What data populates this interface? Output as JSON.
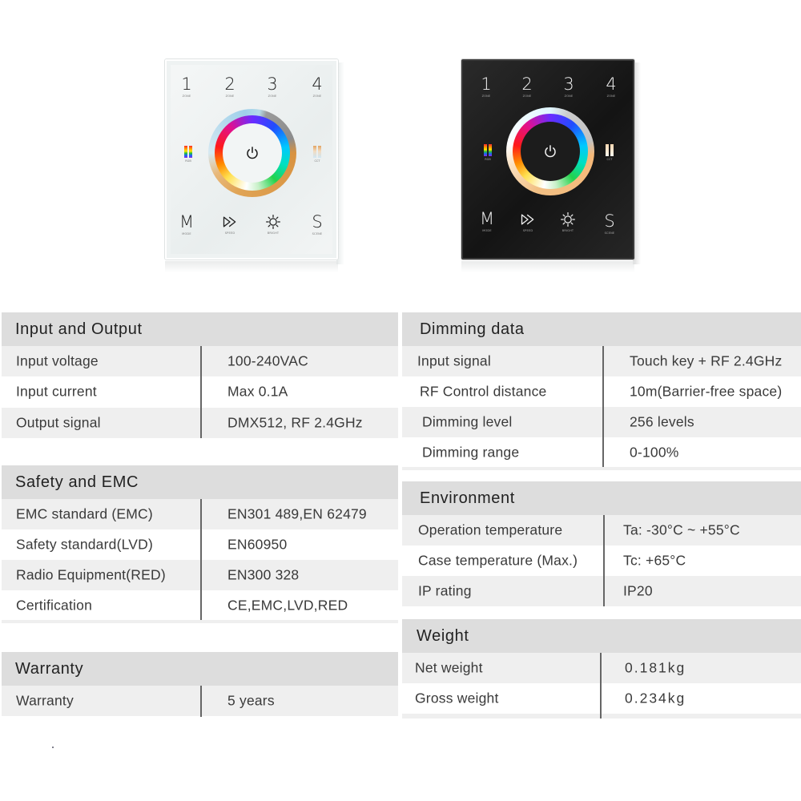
{
  "products": {
    "white_panel": {
      "variant": "white",
      "zone_keys": [
        {
          "number": "1",
          "label": "ZONE"
        },
        {
          "number": "2",
          "label": "ZONE"
        },
        {
          "number": "3",
          "label": "ZONE"
        },
        {
          "number": "4",
          "label": "ZONE"
        }
      ],
      "left_mode_label": "RGB",
      "right_mode_label": "CCT",
      "bottom_keys": [
        {
          "glyph": "M",
          "label": "MODE"
        },
        {
          "glyph": "speed-icon",
          "label": "SPEED"
        },
        {
          "glyph": "brightness-icon",
          "label": "BRIGHT"
        },
        {
          "glyph": "S",
          "label": "SCENE"
        }
      ]
    },
    "black_panel": {
      "variant": "black",
      "zone_keys": [
        {
          "number": "1",
          "label": "ZONE"
        },
        {
          "number": "2",
          "label": "ZONE"
        },
        {
          "number": "3",
          "label": "ZONE"
        },
        {
          "number": "4",
          "label": "ZONE"
        }
      ],
      "left_mode_label": "RGB",
      "right_mode_label": "CCT",
      "bottom_keys": [
        {
          "glyph": "M",
          "label": "MODE"
        },
        {
          "glyph": "speed-icon",
          "label": "SPEED"
        },
        {
          "glyph": "brightness-icon",
          "label": "BRIGHT"
        },
        {
          "glyph": "S",
          "label": "SCENE"
        }
      ]
    }
  },
  "specs": {
    "input_output": {
      "title": "Input and Output",
      "rows": [
        {
          "key": "Input voltage",
          "value": "100-240VAC"
        },
        {
          "key": "Input current",
          "value": "Max 0.1A"
        },
        {
          "key": "Output signal",
          "value": "DMX512, RF 2.4GHz"
        }
      ]
    },
    "safety_emc": {
      "title": "Safety and EMC",
      "rows": [
        {
          "key": "EMC standard (EMC)",
          "value": "EN301 489,EN 62479"
        },
        {
          "key": "Safety standard(LVD)",
          "value": "EN60950"
        },
        {
          "key": "Radio Equipment(RED)",
          "value": "EN300 328"
        },
        {
          "key": "Certification",
          "value": "CE,EMC,LVD,RED"
        }
      ]
    },
    "warranty": {
      "title": "Warranty",
      "rows": [
        {
          "key": "Warranty",
          "value": "5 years"
        }
      ]
    },
    "dimming": {
      "title": "Dimming data",
      "rows": [
        {
          "key": "Input signal",
          "value": "Touch key + RF 2.4GHz"
        },
        {
          "key": "RF Control distance",
          "value": "10m(Barrier-free space)"
        },
        {
          "key": "Dimming level",
          "value": "256 levels"
        },
        {
          "key": "Dimming range",
          "value": "0-100%"
        }
      ]
    },
    "environment": {
      "title": "Environment",
      "rows": [
        {
          "key": "Operation temperature",
          "value": "Ta: -30°C ~ +55°C"
        },
        {
          "key": "Case temperature (Max.)",
          "value": "Tc: +65°C"
        },
        {
          "key": "IP rating",
          "value": "IP20"
        }
      ]
    },
    "weight": {
      "title": "Weight",
      "rows": [
        {
          "key": "Net weight",
          "value": "0.181kg"
        },
        {
          "key": "Gross weight",
          "value": "0.234kg"
        }
      ]
    }
  }
}
